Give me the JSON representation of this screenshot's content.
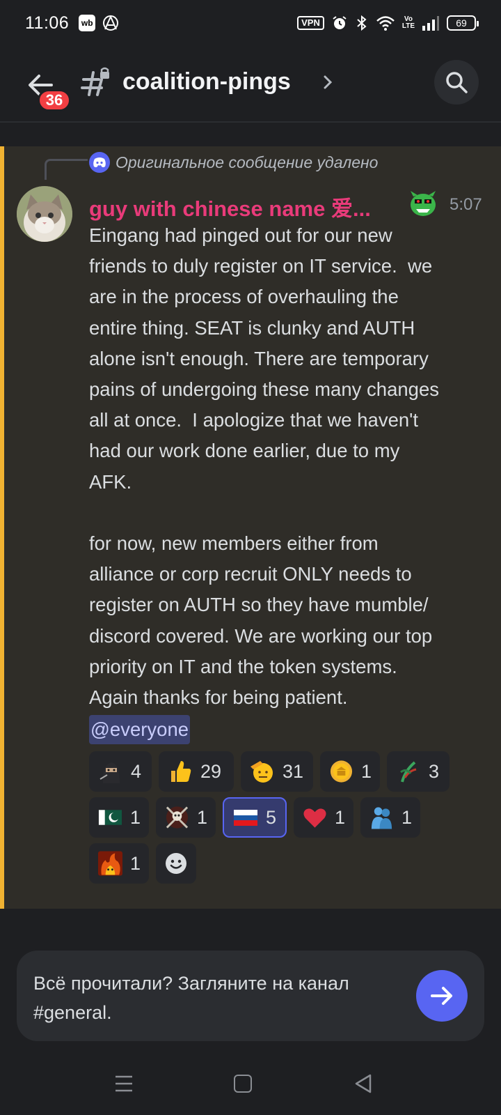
{
  "status_bar": {
    "time": "11:06",
    "wb_label": "wb",
    "vpn_label": "VPN",
    "volte_line1": "Vo",
    "volte_line2": "LTE",
    "battery": "69"
  },
  "header": {
    "back_badge": "36",
    "channel_name": "coalition-pings"
  },
  "message": {
    "reply_text": "Оригинальное сообщение удалено",
    "username": "guy with chinese name 爱...",
    "timestamp": "5:07",
    "body": "Eingang had pinged out for our new\nfriends to duly register on IT service.  we\nare in the process of overhauling the\nentire thing. SEAT is clunky and AUTH\nalone isn't enough. There are temporary\npains of undergoing these many changes\nall at once.  I apologize that we haven't\nhad our work done earlier, due to my\nAFK.\n\nfor now, new members either from\nalliance or corp recruit ONLY needs to\nregister on AUTH so they have mumble/\ndiscord covered. We are working our top\npriority on IT and the token systems.\nAgain thanks for being patient.",
    "mention": "@everyone",
    "reactions": [
      {
        "emoji": "ninja-icon",
        "count": "4",
        "selected": false
      },
      {
        "emoji": "thumbs-up-icon",
        "count": "29",
        "selected": false
      },
      {
        "emoji": "saluting-face-icon",
        "count": "31",
        "selected": false
      },
      {
        "emoji": "coin-icon",
        "count": "1",
        "selected": false
      },
      {
        "emoji": "plant-icon",
        "count": "3",
        "selected": false
      },
      {
        "emoji": "pakistan-flag-icon",
        "count": "1",
        "selected": false
      },
      {
        "emoji": "skull-emblem-icon",
        "count": "1",
        "selected": false
      },
      {
        "emoji": "russia-flag-icon",
        "count": "5",
        "selected": true
      },
      {
        "emoji": "red-heart-icon",
        "count": "1",
        "selected": false
      },
      {
        "emoji": "hugging-people-icon",
        "count": "1",
        "selected": false
      },
      {
        "emoji": "fire-creature-icon",
        "count": "1",
        "selected": false
      }
    ]
  },
  "prompt": {
    "text": "Всё прочитали? Загляните на канал #general."
  },
  "colors": {
    "accent": "#5865f2",
    "username": "#e93b7a",
    "highlight_bar": "#f0b232",
    "badge": "#f23f43"
  }
}
